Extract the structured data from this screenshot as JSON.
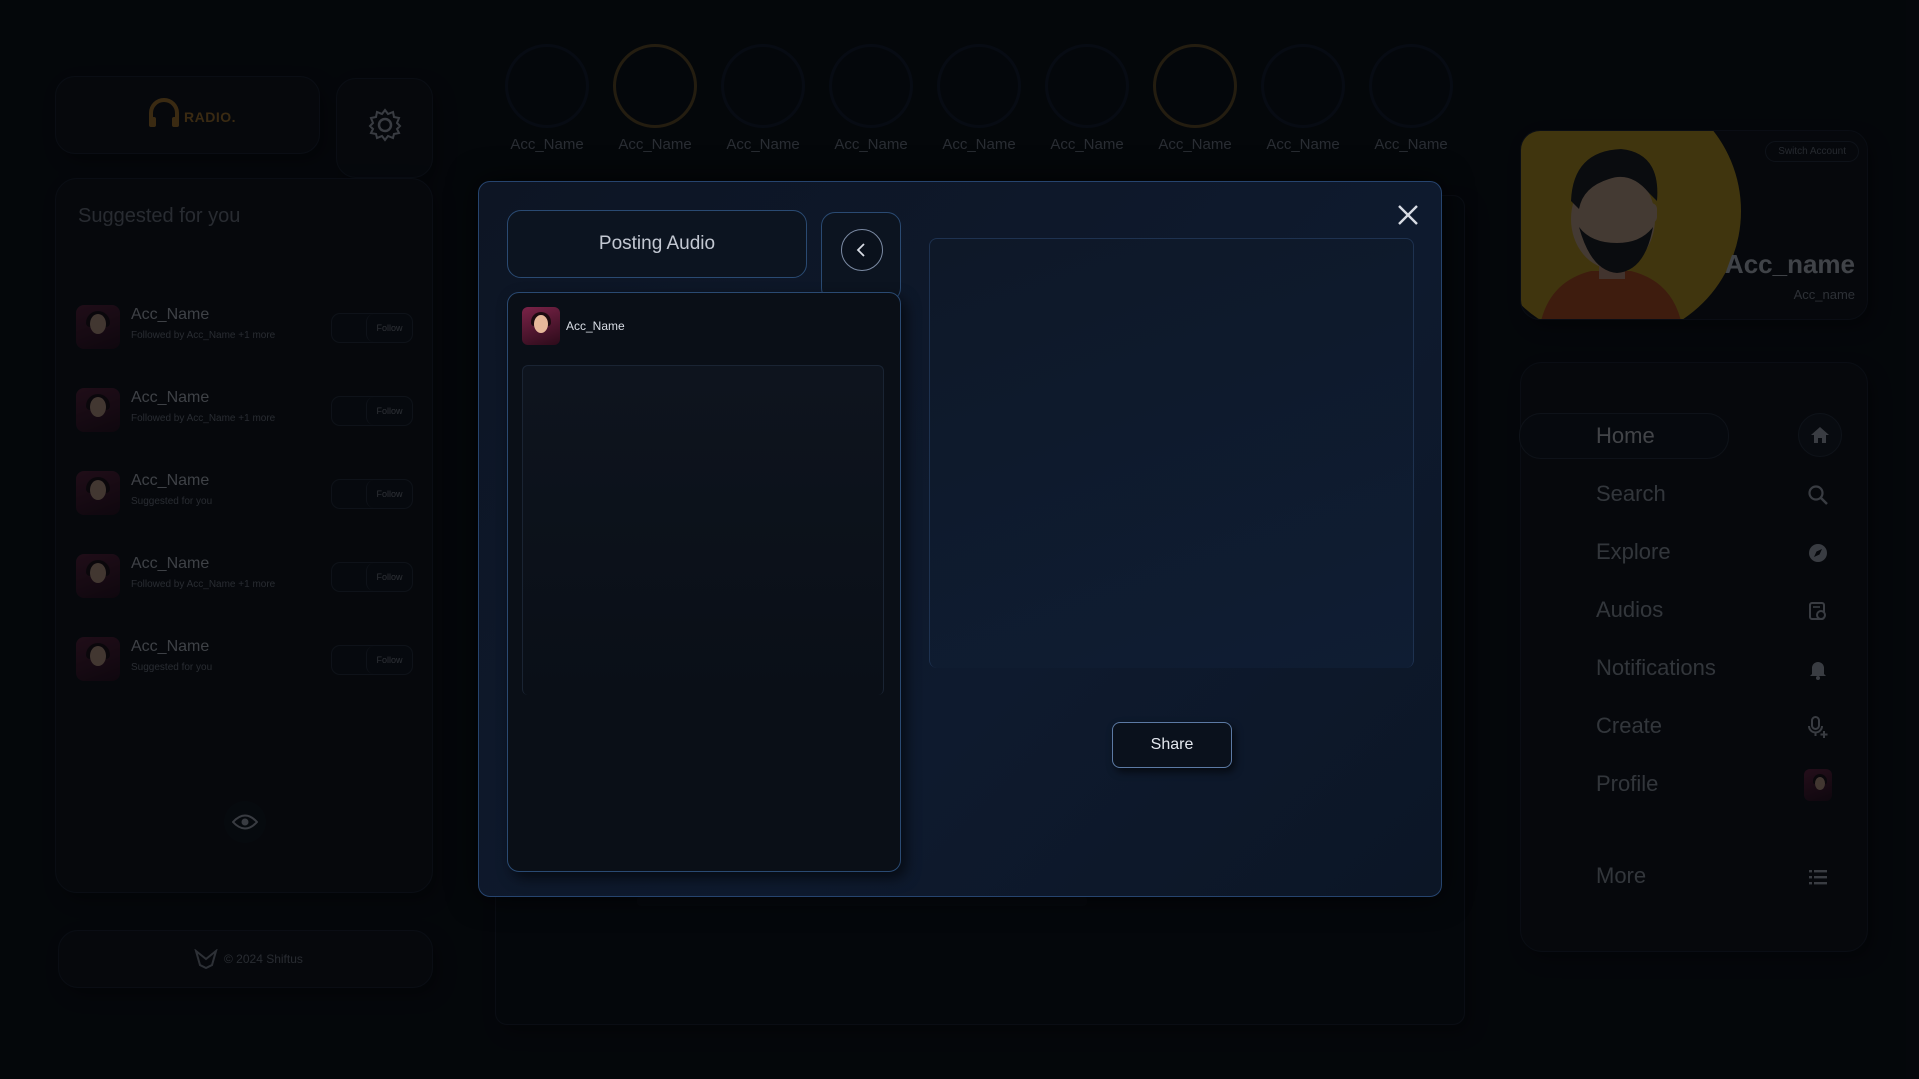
{
  "app": {
    "logo_text": "RADIO.",
    "footer_text": "© 2024 Shiftus"
  },
  "suggested": {
    "title": "Suggested for you",
    "items": [
      {
        "name": "Acc_Name",
        "sub": "Followed by Acc_Name +1 more",
        "follow": "Follow"
      },
      {
        "name": "Acc_Name",
        "sub": "Followed by Acc_Name +1 more",
        "follow": "Follow"
      },
      {
        "name": "Acc_Name",
        "sub": "Suggested for you",
        "follow": "Follow"
      },
      {
        "name": "Acc_Name",
        "sub": "Followed by Acc_Name +1 more",
        "follow": "Follow"
      },
      {
        "name": "Acc_Name",
        "sub": "Suggested for you",
        "follow": "Follow"
      }
    ]
  },
  "stories": [
    {
      "name": "Acc_Name",
      "active": false
    },
    {
      "name": "Acc_Name",
      "active": true
    },
    {
      "name": "Acc_Name",
      "active": false
    },
    {
      "name": "Acc_Name",
      "active": false
    },
    {
      "name": "Acc_Name",
      "active": false
    },
    {
      "name": "Acc_Name",
      "active": false
    },
    {
      "name": "Acc_Name",
      "active": true
    },
    {
      "name": "Acc_Name",
      "active": false
    },
    {
      "name": "Acc_Name",
      "active": false
    }
  ],
  "profile": {
    "switch_label": "Switch Account",
    "name": "Acc_name",
    "handle": "Acc_name"
  },
  "nav": {
    "items": [
      {
        "label": "Home",
        "icon": "home-icon"
      },
      {
        "label": "Search",
        "icon": "search-icon"
      },
      {
        "label": "Explore",
        "icon": "compass-icon"
      },
      {
        "label": "Audios",
        "icon": "audio-library-icon"
      },
      {
        "label": "Notifications",
        "icon": "bell-icon"
      },
      {
        "label": "Create",
        "icon": "microphone-plus-icon"
      },
      {
        "label": "Profile",
        "icon": "profile-avatar-icon"
      },
      {
        "label": "More",
        "icon": "menu-icon"
      }
    ]
  },
  "modal": {
    "title": "Posting Audio",
    "user": "Acc_Name",
    "share_label": "Share"
  },
  "colors": {
    "accent_gold": "#c98a2a",
    "modal_border": "#26446e",
    "profile_yellow": "#e0b21a"
  }
}
